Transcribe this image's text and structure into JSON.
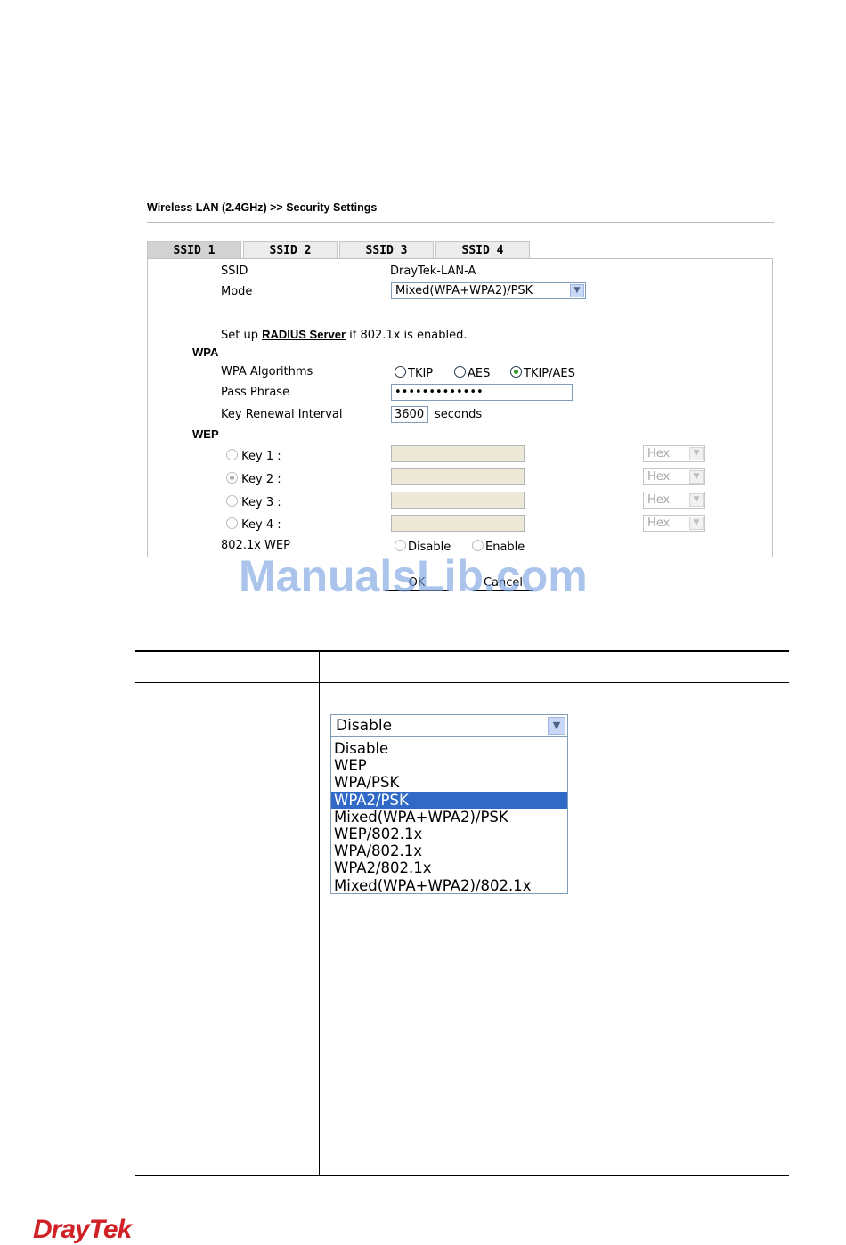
{
  "breadcrumb": "Wireless LAN (2.4GHz) >> Security Settings",
  "tabs": [
    {
      "label": "SSID 1",
      "active": true
    },
    {
      "label": "SSID 2",
      "active": false
    },
    {
      "label": "SSID 3",
      "active": false
    },
    {
      "label": "SSID 4",
      "active": false
    }
  ],
  "ssid": {
    "label": "SSID",
    "value": "DrayTek-LAN-A"
  },
  "mode": {
    "label": "Mode",
    "value": "Mixed(WPA+WPA2)/PSK"
  },
  "radius": {
    "prefix": "Set up ",
    "link": "RADIUS Server",
    "suffix": " if 802.1x is enabled."
  },
  "wpa": {
    "section": "WPA",
    "algorithms_label": "WPA Algorithms",
    "algorithms": [
      {
        "label": "TKIP",
        "checked": false
      },
      {
        "label": "AES",
        "checked": false
      },
      {
        "label": "TKIP/AES",
        "checked": true
      }
    ],
    "passphrase_label": "Pass Phrase",
    "passphrase_value": "•••••••••••••",
    "renewal_label": "Key Renewal Interval",
    "renewal_value": "3600",
    "renewal_unit": "seconds"
  },
  "wep": {
    "section": "WEP",
    "keys": [
      {
        "label": "Key 1 :",
        "checked": false,
        "format": "Hex"
      },
      {
        "label": "Key 2 :",
        "checked": true,
        "format": "Hex"
      },
      {
        "label": "Key 3 :",
        "checked": false,
        "format": "Hex"
      },
      {
        "label": "Key 4 :",
        "checked": false,
        "format": "Hex"
      }
    ],
    "dot1x_label": "802.1x WEP",
    "dot1x_options": [
      {
        "label": "Disable",
        "checked": false
      },
      {
        "label": "Enable",
        "checked": false
      }
    ]
  },
  "buttons": {
    "ok": "OK",
    "cancel": "Cancel"
  },
  "watermark": "ManualsLib.com",
  "dropdown": {
    "selected": "Disable",
    "options": [
      "Disable",
      "WEP",
      "WPA/PSK",
      "WPA2/PSK",
      "Mixed(WPA+WPA2)/PSK",
      "WEP/802.1x",
      "WPA/802.1x",
      "WPA2/802.1x",
      "Mixed(WPA+WPA2)/802.1x"
    ],
    "highlighted_index": 3
  },
  "logo": "DrayTek",
  "colors": {
    "highlight": "#3169c6",
    "logo": "#d02127",
    "watermark": "#76a0e0",
    "radio_checked": "#2c9e1d"
  },
  "icons": {
    "select_arrow": "chevron-down-icon"
  }
}
